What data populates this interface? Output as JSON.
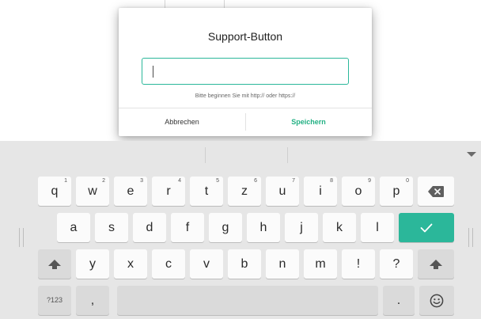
{
  "dialog": {
    "title": "Support-Button",
    "input_value": "",
    "hint": "Bitte beginnen Sie mit http:// oder https://",
    "cancel_label": "Abbrechen",
    "save_label": "Speichern"
  },
  "keyboard": {
    "row1": [
      {
        "label": "q",
        "hint": "1"
      },
      {
        "label": "w",
        "hint": "2"
      },
      {
        "label": "e",
        "hint": "3"
      },
      {
        "label": "r",
        "hint": "4"
      },
      {
        "label": "t",
        "hint": "5"
      },
      {
        "label": "z",
        "hint": "6"
      },
      {
        "label": "u",
        "hint": "7"
      },
      {
        "label": "i",
        "hint": "8"
      },
      {
        "label": "o",
        "hint": "9"
      },
      {
        "label": "p",
        "hint": "0"
      }
    ],
    "row2": [
      "a",
      "s",
      "d",
      "f",
      "g",
      "h",
      "j",
      "k",
      "l"
    ],
    "row3": [
      "y",
      "x",
      "c",
      "v",
      "b",
      "n",
      "m",
      "!",
      "?"
    ],
    "symbols_label": "?123",
    "comma_label": ",",
    "period_label": "."
  },
  "colors": {
    "accent": "#2bb79a",
    "keyboard_bg": "#e6e6e6"
  }
}
